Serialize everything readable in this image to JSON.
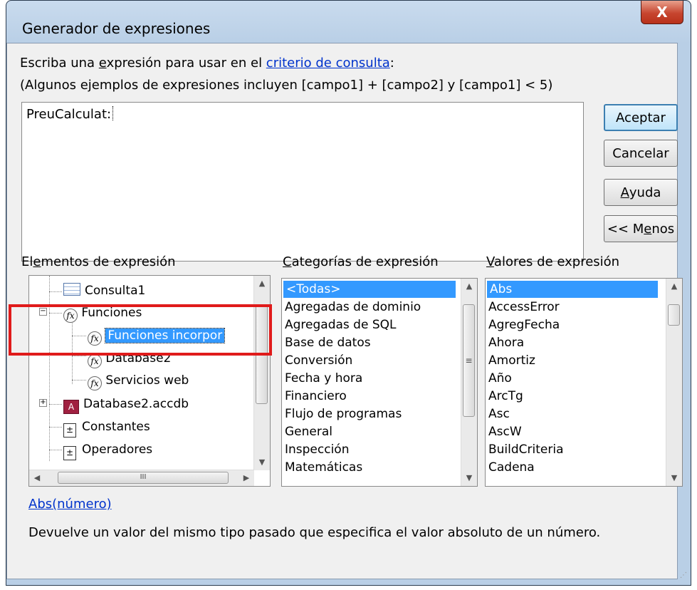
{
  "window": {
    "title": "Generador de expresiones",
    "close_label": "X"
  },
  "prompt": {
    "prefix": "Escriba una ",
    "underlined": "e",
    "middle": "xpresión para usar en el ",
    "link": "criterio de consulta",
    "suffix": ":",
    "examples": "(Algunos ejemplos de expresiones incluyen [campo1] + [campo2] y [campo1] < 5)"
  },
  "expression": {
    "value": "PreuCalculat:"
  },
  "buttons": {
    "ok": "Aceptar",
    "cancel": "Cancelar",
    "help_mn": "A",
    "help_rest": "yuda",
    "less_pre": "<< M",
    "less_mn": "e",
    "less_post": "nos"
  },
  "elements_panel": {
    "label_pre": "El",
    "label_mn": "e",
    "label_post": "mentos de expresión",
    "items": [
      "Consulta1",
      "Funciones",
      "Funciones incorpor",
      "Database2",
      "Servicios web",
      "Database2.accdb",
      "Constantes",
      "Operadores"
    ],
    "selected": "Funciones incorpor",
    "hscroll_grip": "III"
  },
  "categories_panel": {
    "label_mn": "C",
    "label_rest": "ategorías de expresión",
    "items": [
      "<Todas>",
      "Agregadas de dominio",
      "Agregadas de SQL",
      "Base de datos",
      "Conversión",
      "Fecha y hora",
      "Financiero",
      "Flujo de programas",
      "General",
      "Inspección",
      "Matemáticas"
    ],
    "selected": "<Todas>",
    "thumb_grip": "≡"
  },
  "values_panel": {
    "label_mn": "V",
    "label_rest": "alores de expresión",
    "items": [
      "Abs",
      "AccessError",
      "AgregFecha",
      "Ahora",
      "Amortiz",
      "Año",
      "ArcTg",
      "Asc",
      "AscW",
      "BuildCriteria",
      "Cadena"
    ],
    "selected": "Abs"
  },
  "function_signature": "Abs(número)",
  "description": "Devuelve un valor del mismo tipo pasado que especifica el valor absoluto de un número.",
  "icons": [
    "close-icon",
    "query-icon",
    "function-icon",
    "database-icon",
    "constants-icon",
    "operators-icon",
    "scroll-up-icon",
    "scroll-down-icon",
    "scroll-left-icon",
    "scroll-right-icon",
    "resize-grip-icon"
  ],
  "colors": {
    "selection": "#3399ff",
    "link": "#0033cc",
    "highlight_box": "#e01b1b"
  }
}
